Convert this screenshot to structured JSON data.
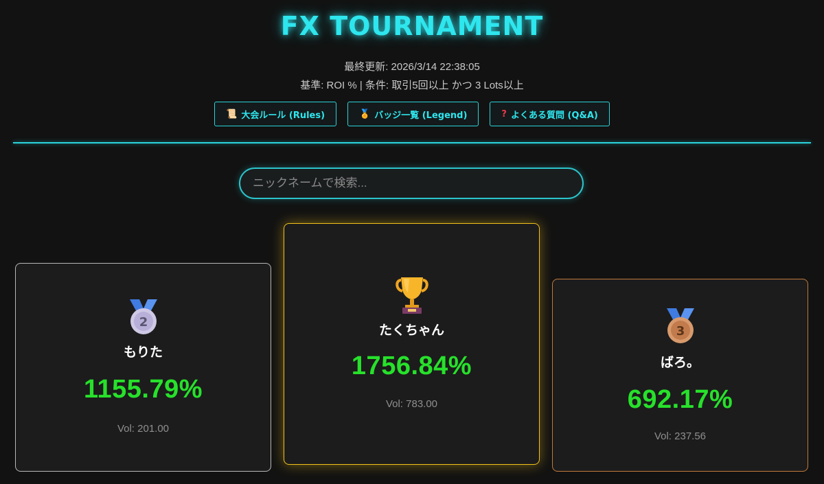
{
  "header": {
    "title": "FX TOURNAMENT",
    "last_updated": "最終更新: 2026/3/14 22:38:05",
    "criteria": "基準: ROI % | 条件: 取引5回以上 かつ 3 Lots以上"
  },
  "nav_buttons": [
    {
      "icon": "scroll-icon",
      "glyph": "📜",
      "label": "大会ルール (Rules)"
    },
    {
      "icon": "medal-icon",
      "glyph": "🏅",
      "label": "バッジ一覧 (Legend)"
    },
    {
      "icon": "question-icon",
      "glyph": "?",
      "label": "よくある質問 (Q&A)"
    }
  ],
  "search": {
    "placeholder": "ニックネームで検索...",
    "value": ""
  },
  "podium": [
    {
      "rank": 2,
      "medal": "silver-medal-icon",
      "name": "もりた",
      "roi": "1155.79%",
      "vol": "Vol: 201.00"
    },
    {
      "rank": 1,
      "medal": "trophy-icon",
      "name": "たくちゃん",
      "roi": "1756.84%",
      "vol": "Vol: 783.00"
    },
    {
      "rank": 3,
      "medal": "bronze-medal-icon",
      "name": "ばろ。",
      "roi": "692.17%",
      "vol": "Vol: 237.56"
    }
  ],
  "colors": {
    "background": "#121212",
    "accent_cyan": "#2ee6ee",
    "roi_green": "#27e12b",
    "gold": "#f2c21a",
    "silver": "#b9b9b9",
    "bronze": "#c27b3a"
  }
}
